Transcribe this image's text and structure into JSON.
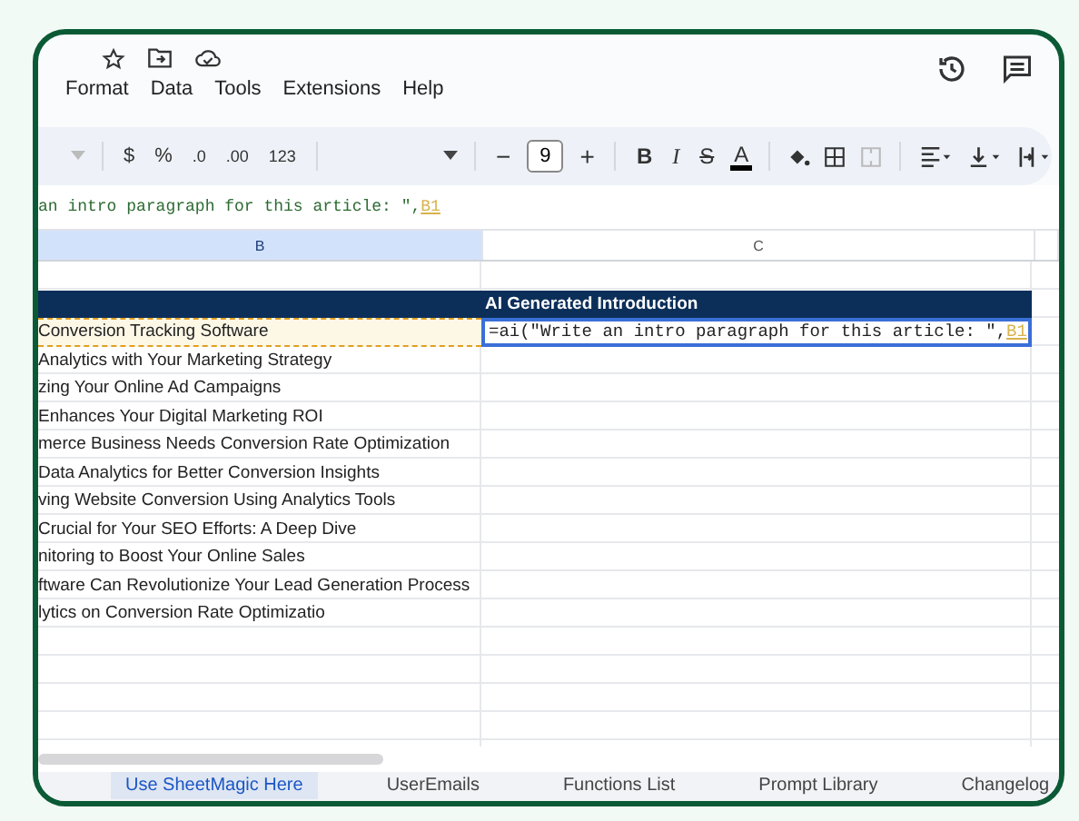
{
  "menu": [
    "Format",
    "Data",
    "Tools",
    "Extensions",
    "Help"
  ],
  "toolbar": {
    "currency": "$",
    "percent": "%",
    "decrease_decimals": ".0",
    "increase_decimals": ".00",
    "number_format": "123",
    "font_size": "9",
    "minus": "−",
    "plus": "+",
    "bold": "B",
    "italic": "I",
    "strike": "S",
    "text_color": "A"
  },
  "formula_bar": {
    "text": "an intro paragraph for this article: \",",
    "ref": "B1"
  },
  "columns": [
    {
      "label": "B",
      "selected": true
    },
    {
      "label": "C",
      "selected": false
    }
  ],
  "table": {
    "header_c": "AI Generated Introduction",
    "rows": [
      {
        "b": "Conversion Tracking Software",
        "selected": true
      },
      {
        "b": "Analytics with Your Marketing Strategy",
        "selected": false
      },
      {
        "b": "zing Your Online Ad Campaigns",
        "selected": false
      },
      {
        "b": "Enhances Your Digital Marketing ROI",
        "selected": false
      },
      {
        "b": "merce Business Needs Conversion Rate Optimization",
        "selected": false
      },
      {
        "b": "Data Analytics for Better Conversion Insights",
        "selected": false
      },
      {
        "b": "ving Website Conversion Using Analytics Tools",
        "selected": false
      },
      {
        "b": "Crucial for Your SEO Efforts: A Deep Dive",
        "selected": false
      },
      {
        "b": "nitoring to Boost Your Online Sales",
        "selected": false
      },
      {
        "b": "ftware Can Revolutionize Your Lead Generation Process",
        "selected": false
      },
      {
        "b": "lytics on Conversion Rate Optimizatio",
        "selected": false
      }
    ],
    "active_cell": {
      "text": "=ai(\"Write an intro paragraph for this article: \",",
      "ref": "B1"
    }
  },
  "sheet_tabs": [
    {
      "label": "Use SheetMagic Here",
      "selected": true
    },
    {
      "label": "UserEmails",
      "selected": false
    },
    {
      "label": "Functions List",
      "selected": false
    },
    {
      "label": "Prompt Library",
      "selected": false
    },
    {
      "label": "Changelog",
      "selected": false
    }
  ]
}
